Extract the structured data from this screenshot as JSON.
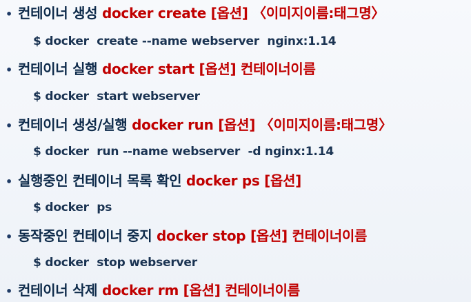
{
  "items": [
    {
      "bullet": "•",
      "korean": "컨테이너 생성 ",
      "command": "docker create [옵션] 〈이미지이름:태그명〉",
      "example": "$ docker  create --name webserver  nginx:1.14"
    },
    {
      "bullet": "•",
      "korean": "컨테이너 실행 ",
      "command": "docker start [옵션] 컨테이너이름",
      "example": "$ docker  start webserver"
    },
    {
      "bullet": "•",
      "korean": "컨테이너 생성/실행 ",
      "command": "docker run [옵션] 〈이미지이름:태그명〉",
      "example": "$ docker  run --name webserver  -d nginx:1.14"
    },
    {
      "bullet": "•",
      "korean": "실행중인 컨테이너 목록 확인 ",
      "command": "docker ps [옵션]",
      "example": "$ docker  ps"
    },
    {
      "bullet": "•",
      "korean": "동작중인 컨테이너 중지 ",
      "command": "docker stop [옵션] 컨테이너이름",
      "example": "$ docker  stop webserver"
    },
    {
      "bullet": "•",
      "korean": "컨테이너 삭제 ",
      "command": "docker rm [옵션] 컨테이너이름",
      "example": ""
    }
  ]
}
